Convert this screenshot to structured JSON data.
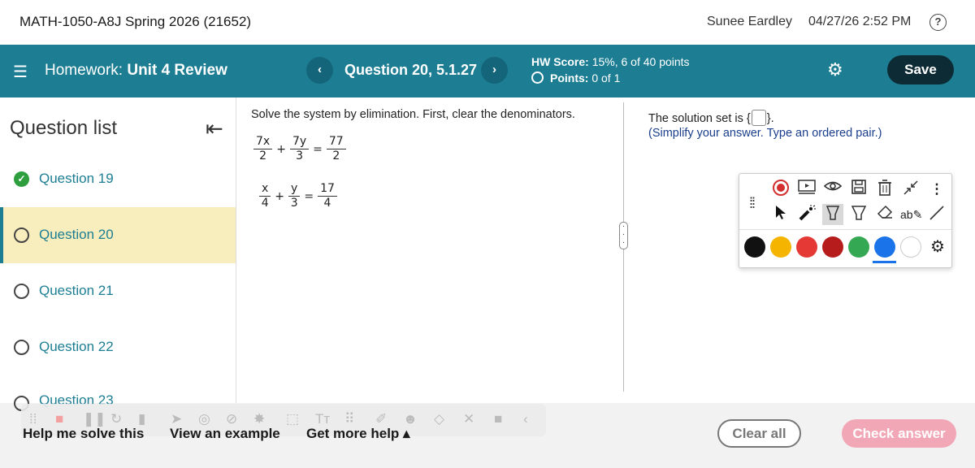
{
  "header": {
    "course": "MATH-1050-A8J Spring 2026 (21652)",
    "user": "Sunee Eardley",
    "datetime": "04/27/26 2:52 PM",
    "help_glyph": "?"
  },
  "hwbar": {
    "menu_glyph": "☰",
    "homework_label": "Homework:",
    "homework_title": "Unit 4 Review",
    "prev_glyph": "‹",
    "next_glyph": "›",
    "question_title": "Question 20, 5.1.27",
    "score_label": "HW Score:",
    "score_value": "15%, 6 of 40 points",
    "points_label": "Points:",
    "points_value": "0 of 1",
    "gear_glyph": "⚙",
    "save_label": "Save"
  },
  "sidebar": {
    "title": "Question list",
    "collapse_glyph": "⇤",
    "items": [
      {
        "label": "Question 19",
        "status": "complete"
      },
      {
        "label": "Question 20",
        "status": "current"
      },
      {
        "label": "Question 21",
        "status": "open"
      },
      {
        "label": "Question 22",
        "status": "open"
      },
      {
        "label": "Question 23",
        "status": "open"
      }
    ]
  },
  "problem": {
    "prompt": "Solve the system by elimination. First, clear the denominators.",
    "eq1": {
      "n1": "7x",
      "d1": "2",
      "op": "+",
      "n2": "7y",
      "d2": "3",
      "eq": "=",
      "n3": "77",
      "d3": "2"
    },
    "eq2": {
      "n1": "x",
      "d1": "4",
      "op": "+",
      "n2": "y",
      "d2": "3",
      "eq": "=",
      "n3": "17",
      "d3": "4"
    }
  },
  "answer": {
    "prefix": "The solution set is",
    "open_brace": "{",
    "close_brace": "}.",
    "instruction": "(Simplify your answer. Type an ordered pair.)"
  },
  "toolbox": {
    "grip": "⁞⁞",
    "icons_row1": [
      "record-icon",
      "screen-icon",
      "eye-icon",
      "save-disk-icon",
      "trash-icon",
      "shrink-icon",
      "more-icon"
    ],
    "icons_row2": [
      "pointer-icon",
      "laser-icon",
      "highlighter-icon",
      "marker-icon",
      "eraser-icon",
      "text-icon",
      "line-icon"
    ],
    "colors": [
      "#111111",
      "#f4b400",
      "#e53935",
      "#b71c1c",
      "#34a853",
      "#1a73e8",
      "#ffffff"
    ],
    "selected_color": "#1a73e8"
  },
  "footer": {
    "help_me": "Help me solve this",
    "example": "View an example",
    "more_help": "Get more help ▴",
    "clear_all": "Clear all",
    "check_answer": "Check answer"
  }
}
